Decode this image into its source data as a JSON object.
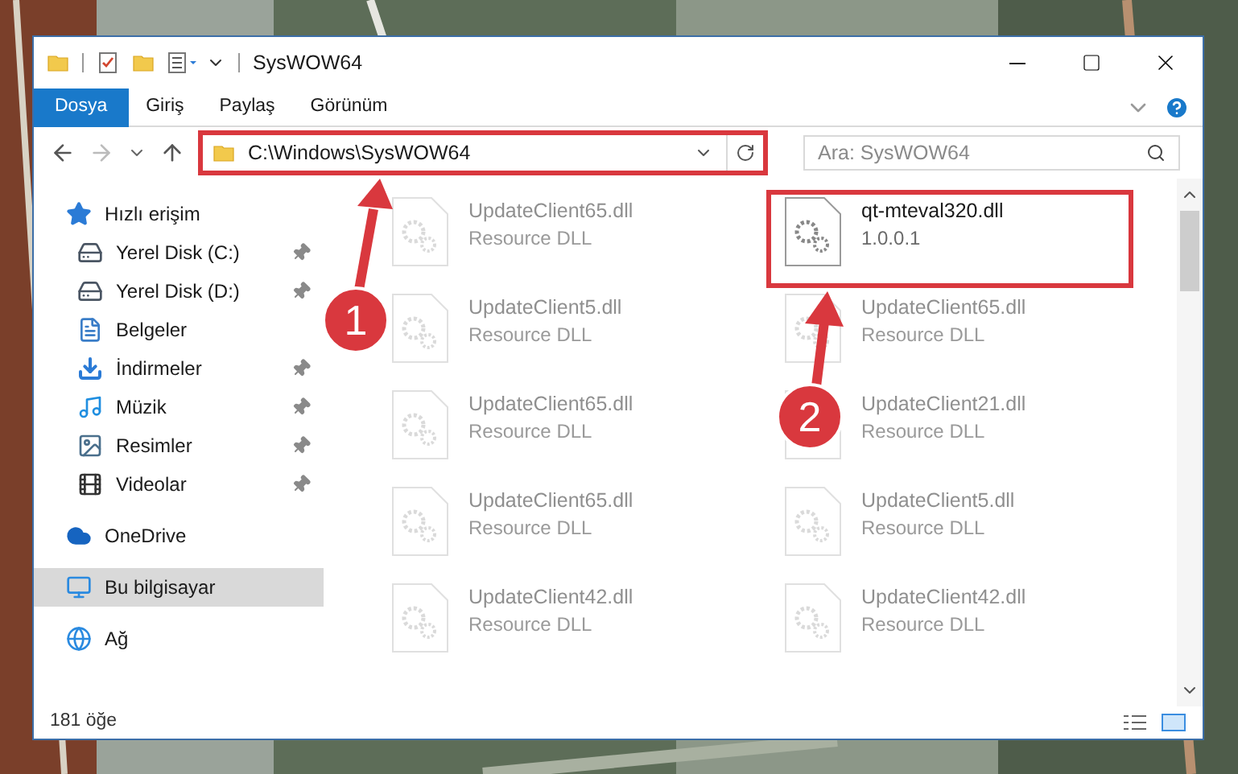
{
  "window": {
    "title": "SysWOW64"
  },
  "ribbon_tabs": [
    {
      "label": "Dosya",
      "selected": true
    },
    {
      "label": "Giriş",
      "selected": false
    },
    {
      "label": "Paylaş",
      "selected": false
    },
    {
      "label": "Görünüm",
      "selected": false
    }
  ],
  "address": {
    "path": "C:\\Windows\\SysWOW64"
  },
  "search": {
    "placeholder": "Ara: SysWOW64"
  },
  "sidebar": {
    "items": [
      {
        "label": "Hızlı erişim",
        "selected": false,
        "children": [
          {
            "label": "Yerel Disk (C:)",
            "pinned": true,
            "selected": false
          },
          {
            "label": "Yerel Disk (D:)",
            "pinned": true,
            "selected": false
          },
          {
            "label": "Belgeler",
            "pinned": false,
            "selected": false
          },
          {
            "label": "İndirmeler",
            "pinned": true,
            "selected": false
          },
          {
            "label": "Müzik",
            "pinned": true,
            "selected": false
          },
          {
            "label": "Resimler",
            "pinned": true,
            "selected": false
          },
          {
            "label": "Videolar",
            "pinned": true,
            "selected": false
          }
        ]
      },
      {
        "label": "OneDrive",
        "selected": false
      },
      {
        "label": "Bu bilgisayar",
        "selected": true
      },
      {
        "label": "Ağ",
        "selected": false
      }
    ]
  },
  "files": [
    {
      "name": "UpdateClient65.dll",
      "detail": "Resource DLL",
      "dimmed": true
    },
    {
      "name": "qt-mteval320.dll",
      "detail": "1.0.0.1",
      "dimmed": false
    },
    {
      "name": "UpdateClient5.dll",
      "detail": "Resource DLL",
      "dimmed": true
    },
    {
      "name": "UpdateClient65.dll",
      "detail": "Resource DLL",
      "dimmed": true
    },
    {
      "name": "UpdateClient65.dll",
      "detail": "Resource DLL",
      "dimmed": true
    },
    {
      "name": "UpdateClient21.dll",
      "detail": "Resource DLL",
      "dimmed": true
    },
    {
      "name": "UpdateClient65.dll",
      "detail": "Resource DLL",
      "dimmed": true
    },
    {
      "name": "UpdateClient5.dll",
      "detail": "Resource DLL",
      "dimmed": true
    },
    {
      "name": "UpdateClient42.dll",
      "detail": "Resource DLL",
      "dimmed": true
    },
    {
      "name": "UpdateClient42.dll",
      "detail": "Resource DLL",
      "dimmed": true
    }
  ],
  "status_bar": {
    "count": "181 öğe"
  },
  "callouts": [
    {
      "number": "1"
    },
    {
      "number": "2"
    }
  ]
}
